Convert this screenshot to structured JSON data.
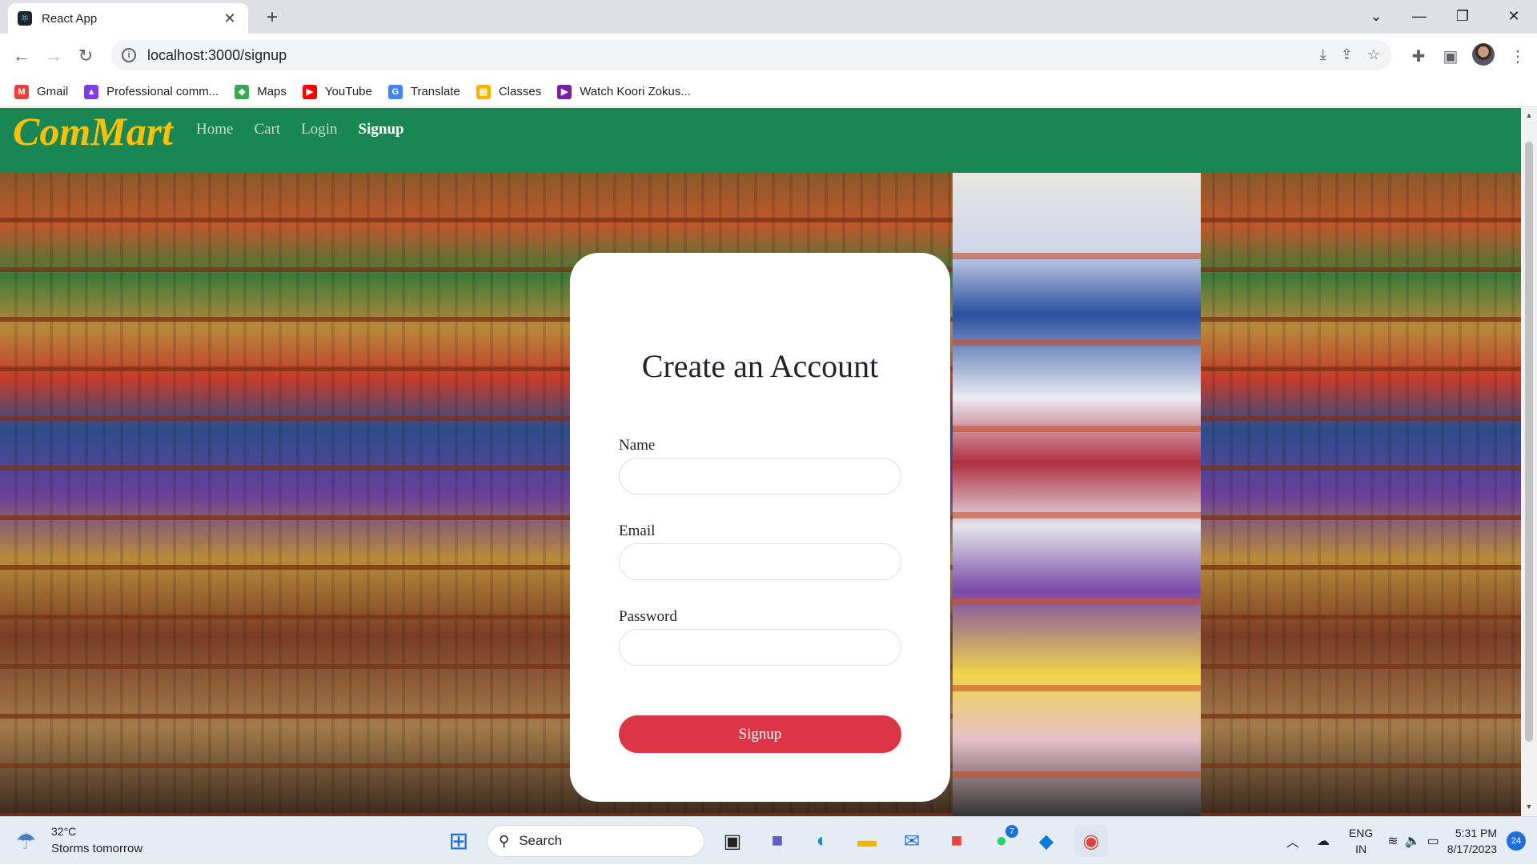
{
  "browser": {
    "tab_title": "React App",
    "tab_icon": "react-icon",
    "url": "localhost:3000/signup",
    "bookmarks": [
      {
        "label": "Gmail",
        "icon": "gmail-icon",
        "color": "#ea4335"
      },
      {
        "label": "Professional comm...",
        "icon": "professional-icon",
        "color": "#7b3fe4"
      },
      {
        "label": "Maps",
        "icon": "maps-icon",
        "color": "#34a853"
      },
      {
        "label": "YouTube",
        "icon": "youtube-icon",
        "color": "#ff0000"
      },
      {
        "label": "Translate",
        "icon": "translate-icon",
        "color": "#4285f4"
      },
      {
        "label": "Classes",
        "icon": "classes-icon",
        "color": "#f4b400"
      },
      {
        "label": "Watch Koori Zokus...",
        "icon": "play-icon",
        "color": "#7b1fa2"
      }
    ]
  },
  "app": {
    "brand": "ComMart",
    "brand_color": "#ffc107",
    "navbar_color": "#198754",
    "nav": {
      "home": "Home",
      "cart": "Cart",
      "login": "Login",
      "signup": "Signup"
    },
    "active_nav": "signup"
  },
  "signup_form": {
    "title": "Create an Account",
    "name_label": "Name",
    "name_value": "",
    "email_label": "Email",
    "email_value": "",
    "password_label": "Password",
    "password_value": "",
    "submit_label": "Signup",
    "submit_color": "#dc3545"
  },
  "taskbar": {
    "weather_temp": "32°C",
    "weather_desc": "Storms tomorrow",
    "search_placeholder": "Search",
    "whatsapp_badge": "7",
    "language_top": "ENG",
    "language_bottom": "IN",
    "time": "5:31 PM",
    "date": "8/17/2023",
    "notification_count": "24"
  }
}
